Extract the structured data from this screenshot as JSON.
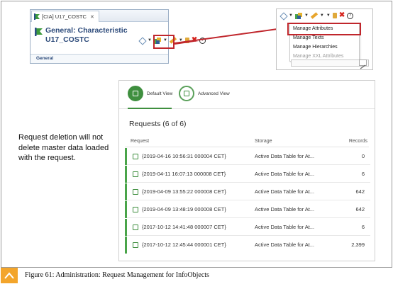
{
  "editor": {
    "tab_label": "[CIA] U17_COSTC",
    "tab_close": "✕",
    "title_line1": "General: Characteristic",
    "title_line2": "U17_COSTC",
    "section": "General"
  },
  "dropdown_menu": {
    "items": [
      {
        "label": "Manage Attributes",
        "enabled": true,
        "highlighted": true
      },
      {
        "label": "Manage Texts",
        "enabled": true
      },
      {
        "label": "Manage Hierarchies",
        "enabled": true
      },
      {
        "label": "Manage XXL Attributes",
        "enabled": false
      }
    ]
  },
  "views": {
    "default_label": "Default View",
    "advanced_label": "Advanced View",
    "active": "default"
  },
  "requests": {
    "title": "Requests (6 of 6)",
    "columns": [
      "Request",
      "Storage",
      "Records"
    ],
    "rows": [
      {
        "request": "{2019-04-16 10:56:31 000004 CET}",
        "storage": "Active Data Table for At...",
        "records": "0"
      },
      {
        "request": "{2019-04-11 16:07:13 000008 CET}",
        "storage": "Active Data Table for At...",
        "records": "6"
      },
      {
        "request": "{2019-04-09 13:55:22 000008 CET}",
        "storage": "Active Data Table for At...",
        "records": "642"
      },
      {
        "request": "{2019-04-09 13:48:19 000008 CET}",
        "storage": "Active Data Table for At...",
        "records": "642"
      },
      {
        "request": "{2017-10-12 14:41:48 000007 CET}",
        "storage": "Active Data Table for At...",
        "records": "6"
      },
      {
        "request": "{2017-10-12 12:45:44 000001 CET}",
        "storage": "Active Data Table for At...",
        "records": "2,399"
      }
    ]
  },
  "note": "Request deletion will not delete master data loaded with the request.",
  "caption": "Figure 61: Administration: Request Management for InfoObjects",
  "colors": {
    "highlight": "#c0262c",
    "accent_green": "#3f8f3f",
    "caption_icon": "#f3a52b"
  }
}
